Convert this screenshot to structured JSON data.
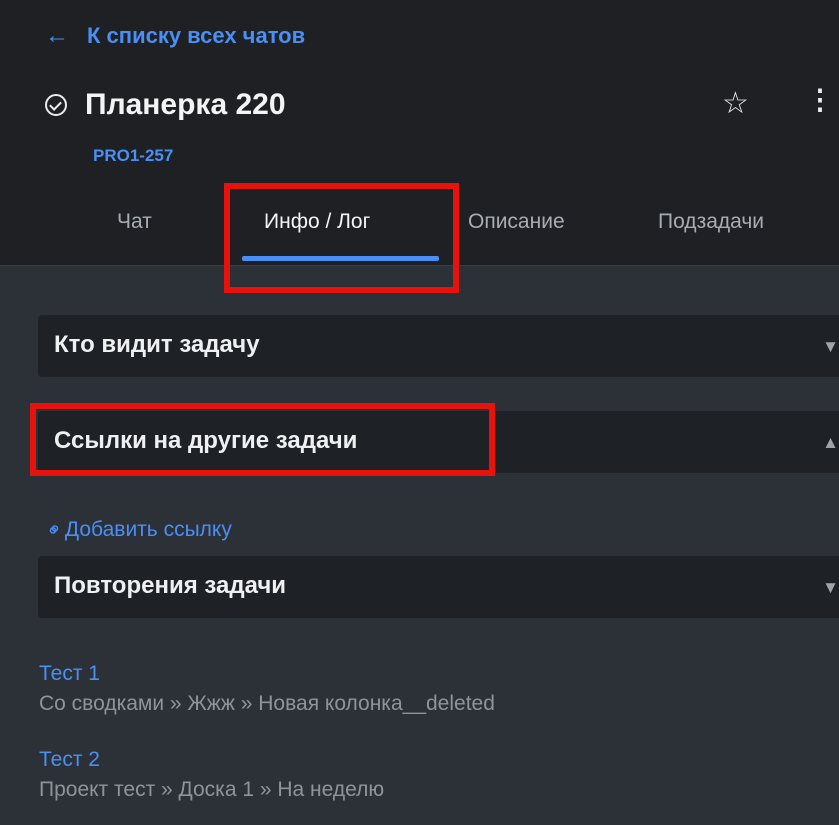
{
  "header": {
    "back_label": "К списку всех чатов",
    "title": "Планерка 220",
    "task_id": "PRO1-257",
    "icons": {
      "back": "arrow-left-icon",
      "status": "check-circle-icon",
      "favorite": "star-icon",
      "more": "more-vertical-icon"
    }
  },
  "tabs": [
    {
      "label": "Чат",
      "active": false
    },
    {
      "label": "Инфо / Лог",
      "active": true
    },
    {
      "label": "Описание",
      "active": false
    },
    {
      "label": "Подзадачи",
      "active": false
    }
  ],
  "sections": {
    "visibility": {
      "title": "Кто видит задачу",
      "expanded": false
    },
    "links": {
      "title": "Ссылки на другие задачи",
      "expanded": true,
      "add_link_label": "Добавить ссылку"
    },
    "repeats": {
      "title": "Повторения задачи",
      "expanded": false
    }
  },
  "repeat_items": [
    {
      "title": "Тест 1",
      "path": "Со сводками » Жжж » Новая колонка__deleted"
    },
    {
      "title": "Тест 2",
      "path": "Проект тест » Доска 1 » На неделю"
    }
  ],
  "colors": {
    "accent": "#4a8ff5",
    "highlight": "#e8120c",
    "header_bg": "#1e2023",
    "panel_bg": "#2c3138",
    "section_bg": "#1e2125"
  }
}
